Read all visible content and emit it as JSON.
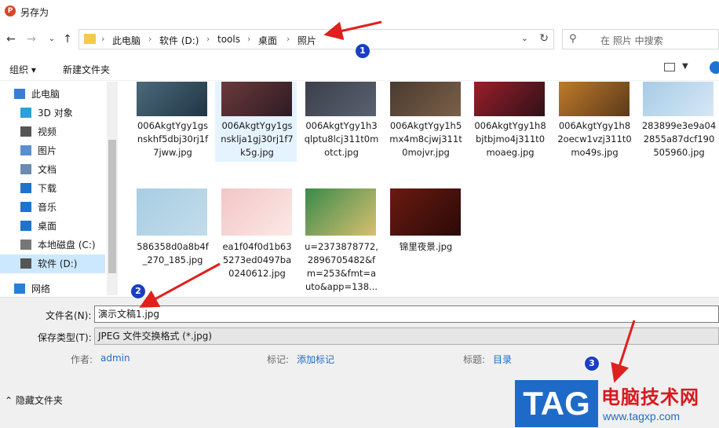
{
  "window": {
    "title": "另存为",
    "app_icon": "powerpoint-icon"
  },
  "nav": {
    "breadcrumbs": [
      "此电脑",
      "软件 (D:)",
      "tools",
      "桌面",
      "照片"
    ],
    "search_placeholder": "在 照片 中搜索"
  },
  "toolbar": {
    "organize": "组织 ▾",
    "new_folder": "新建文件夹"
  },
  "sidebar": {
    "items": [
      {
        "label": "此电脑",
        "icon": "computer-icon",
        "color": "#3a7bd5"
      },
      {
        "label": "3D 对象",
        "icon": "cube-icon",
        "color": "#2aa1d8"
      },
      {
        "label": "视频",
        "icon": "video-icon",
        "color": "#555555"
      },
      {
        "label": "图片",
        "icon": "picture-icon",
        "color": "#5a8fd0"
      },
      {
        "label": "文档",
        "icon": "document-icon",
        "color": "#6d8bb0"
      },
      {
        "label": "下载",
        "icon": "download-icon",
        "color": "#1e73d1"
      },
      {
        "label": "音乐",
        "icon": "music-icon",
        "color": "#1e73d1"
      },
      {
        "label": "桌面",
        "icon": "desktop-icon",
        "color": "#1e73d1"
      },
      {
        "label": "本地磁盘 (C:)",
        "icon": "drive-icon",
        "color": "#777777"
      },
      {
        "label": "软件 (D:)",
        "icon": "drive-icon",
        "color": "#555555"
      },
      {
        "label": "网络",
        "icon": "network-icon",
        "color": "#2a7fd4"
      }
    ]
  },
  "files": [
    {
      "name": "006AkgtYgy1gsnskhf5dbj30rj1f7jww.jpg",
      "lines": [
        "006AkgtYgy1gs",
        "nskhf5dbj30rj1f",
        "7jww.jpg"
      ],
      "colors": [
        "#4b6a7a",
        "#203544"
      ]
    },
    {
      "name": "006AkgtYgy1gsnsklja1gj30rj1f7k5g.jpg",
      "lines": [
        "006AkgtYgy1gs",
        "nsklja1gj30rj1f7",
        "k5g.jpg"
      ],
      "colors": [
        "#6b3a3a",
        "#2d1b24"
      ]
    },
    {
      "name": "006AkgtYgy1h3qlptu8lcj311t0motct.jpg",
      "lines": [
        "006AkgtYgy1h3",
        "qlptu8lcj311t0m",
        "otct.jpg"
      ],
      "colors": [
        "#3b3f4a",
        "#5a6270"
      ]
    },
    {
      "name": "006AkgtYgy1h5mx4m8cjwj311t0mojvr.jpg",
      "lines": [
        "006AkgtYgy1h5",
        "mx4m8cjwj311t",
        "0mojvr.jpg"
      ],
      "colors": [
        "#4a3a30",
        "#7a6048"
      ]
    },
    {
      "name": "006AkgtYgy1h8bjtbjmo4j311t0moaeg.jpg",
      "lines": [
        "006AkgtYgy1h8",
        "bjtbjmo4j311t0",
        "moaeg.jpg"
      ],
      "colors": [
        "#9a1f2a",
        "#301018"
      ]
    },
    {
      "name": "006AkgtYgy1h82oecw1vzj311t0mo49s.jpg",
      "lines": [
        "006AkgtYgy1h8",
        "2oecw1vzj311t0",
        "mo49s.jpg"
      ],
      "colors": [
        "#c07a2a",
        "#5a3a1a"
      ]
    },
    {
      "name": "283899e3e9a042855a87dcf190505960.jpg",
      "lines": [
        "283899e3e9a04",
        "2855a87dcf190",
        "505960.jpg"
      ],
      "colors": [
        "#a7cbe6",
        "#d6e8f5"
      ]
    },
    {
      "name": "586358d0a8b4f_270_185.jpg",
      "lines": [
        "586358d0a8b4f",
        "_270_185.jpg"
      ],
      "colors": [
        "#a8cde2",
        "#c2dceb"
      ]
    },
    {
      "name": "ea1f04f0d1b635273ed0497ba0240612.jpg",
      "lines": [
        "ea1f04f0d1b63",
        "5273ed0497ba",
        "0240612.jpg"
      ],
      "colors": [
        "#f2c6c6",
        "#fbe9e6"
      ]
    },
    {
      "name": "u=2373878772,2896705482&fm=253&fmt=auto&app=138...",
      "lines": [
        "u=2373878772,",
        "2896705482&f",
        "m=253&fmt=a",
        "uto&app=138..."
      ],
      "colors": [
        "#3a8a4a",
        "#d8c070"
      ]
    },
    {
      "name": "锦里夜景.jpg",
      "lines": [
        "锦里夜景.jpg"
      ],
      "colors": [
        "#6a1a10",
        "#2a0a08"
      ]
    }
  ],
  "form": {
    "filename_label": "文件名(N):",
    "filename_value": "演示文稿1.jpg",
    "filetype_label": "保存类型(T):",
    "filetype_value": "JPEG 文件交换格式 (*.jpg)",
    "author_label": "作者:",
    "author_value": "admin",
    "tags_label": "标记:",
    "tags_value": "添加标记",
    "title_label": "标题:",
    "title_value": "目录",
    "hide_folders": "隐藏文件夹"
  },
  "annotations": {
    "markers": [
      "1",
      "2",
      "3"
    ],
    "arrow_color": "#e0201e",
    "marker_color": "#1a3fc4"
  },
  "watermark": {
    "tag": "TAG",
    "site_name": "电脑技术网",
    "url": "www.tagxp.com"
  }
}
